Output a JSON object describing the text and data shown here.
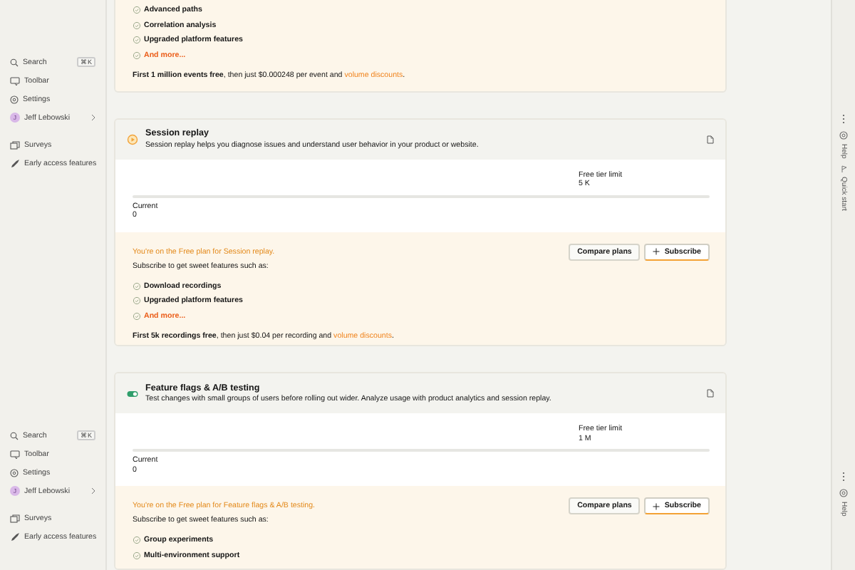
{
  "sidebar_groups": [
    {
      "items": [
        {
          "kind": "search",
          "label": "Search",
          "shortcut": "⌘K"
        },
        {
          "kind": "toolbar",
          "label": "Toolbar"
        },
        {
          "kind": "settings",
          "label": "Settings"
        },
        {
          "kind": "user",
          "label": "Jeff Lebowski",
          "avatar": "J"
        },
        {
          "kind": "surveys",
          "label": "Surveys"
        },
        {
          "kind": "early_access",
          "label": "Early access features"
        }
      ]
    },
    {
      "items": [
        {
          "kind": "search",
          "label": "Search",
          "shortcut": "⌘K"
        },
        {
          "kind": "toolbar",
          "label": "Toolbar"
        },
        {
          "kind": "settings",
          "label": "Settings"
        },
        {
          "kind": "user",
          "label": "Jeff Lebowski",
          "avatar": "J"
        },
        {
          "kind": "surveys",
          "label": "Surveys"
        },
        {
          "kind": "early_access",
          "label": "Early access features"
        }
      ]
    }
  ],
  "products": [
    {
      "plan": {
        "features": [
          "Advanced paths",
          "Correlation analysis",
          "Upgraded platform features"
        ],
        "and_more": "And more...",
        "footer": {
          "text": "**First 1 million events free**, then just $0.000248 per event and ",
          "link": "volume discounts",
          "end": "."
        }
      }
    },
    {
      "kind": "replay",
      "title": "Session replay",
      "description": "Session replay helps you diagnose issues and understand user behavior in your product or website.",
      "usage": {
        "limit_label": "Free tier limit",
        "limit": "5 K",
        "current_label": "Current",
        "current": "0",
        "level": 0
      },
      "plan": {
        "notice": "You're on the Free plan for Session replay.",
        "intro": "Subscribe to get sweet features such as:",
        "buttons": [
          {
            "kind": "secondary",
            "label": "Compare plans"
          },
          {
            "kind": "primary",
            "label": "Subscribe"
          }
        ],
        "features": [
          "Download recordings",
          "Upgraded platform features"
        ],
        "and_more": "And more...",
        "footer": {
          "text": "**First 5k recordings free**, then just $0.04 per recording and ",
          "link": "volume discounts",
          "end": "."
        }
      }
    },
    {
      "kind": "flags",
      "title": "Feature flags & A/B testing",
      "description": "Test changes with small groups of users before rolling out wider. Analyze usage with product analytics and session replay.",
      "usage": {
        "limit_label": "Free tier limit",
        "limit": "1 M",
        "current_label": "Current",
        "current": "0",
        "level": 0
      },
      "plan": {
        "notice": "You're on the Free plan for Feature flags & A/B testing.",
        "intro": "Subscribe to get sweet features such as:",
        "buttons": [
          {
            "kind": "secondary",
            "label": "Compare plans"
          },
          {
            "kind": "primary",
            "label": "Subscribe"
          }
        ],
        "features": [
          "Group experiments",
          "Multi-environment support"
        ]
      }
    }
  ],
  "right_bar_groups": [
    {
      "items": [
        {
          "kind": "help",
          "label": "Help"
        },
        {
          "kind": "quick_start",
          "label": "Quick start"
        }
      ]
    },
    {
      "items": [
        {
          "kind": "help",
          "label": "Help"
        }
      ]
    }
  ]
}
